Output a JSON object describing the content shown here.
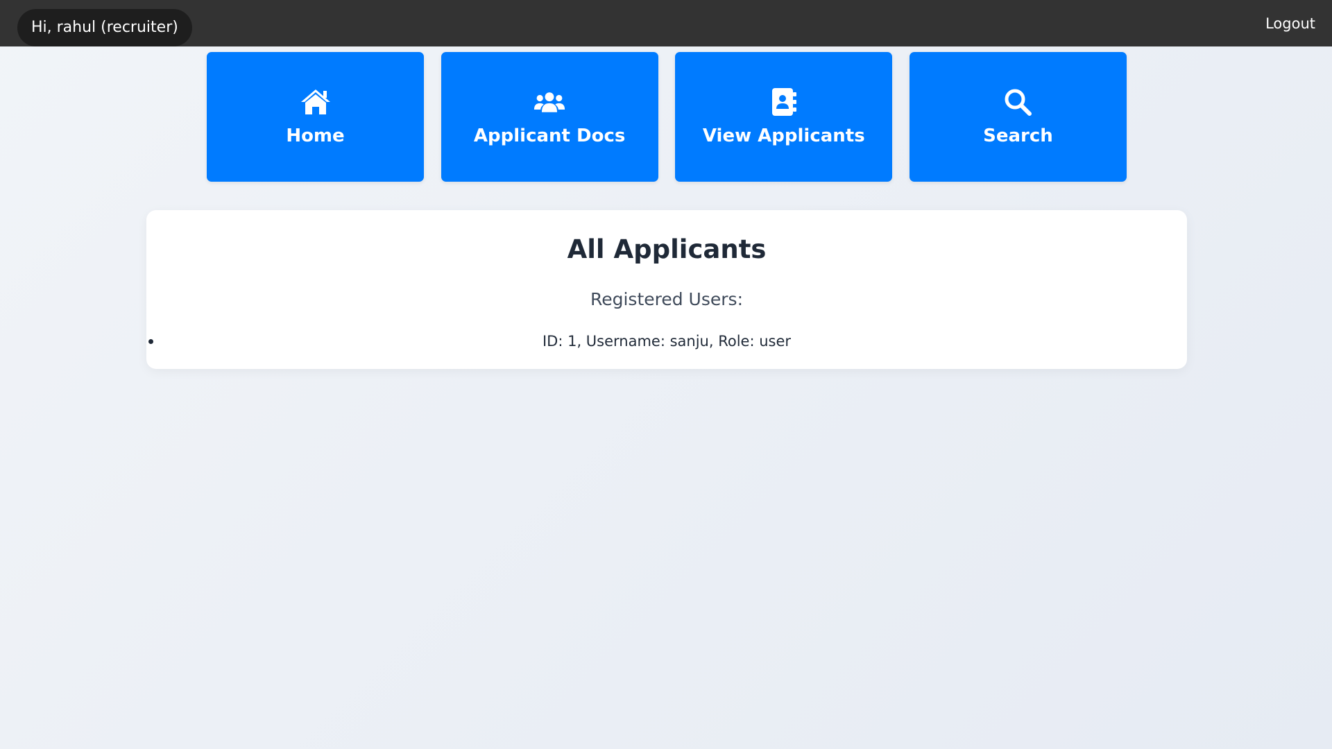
{
  "topbar": {
    "greeting": "Hi, rahul (recruiter)",
    "logout_label": "Logout"
  },
  "nav": [
    {
      "label": "Home",
      "icon": "home-icon"
    },
    {
      "label": "Applicant Docs",
      "icon": "users-icon"
    },
    {
      "label": "View Applicants",
      "icon": "address-book-icon"
    },
    {
      "label": "Search",
      "icon": "search-icon"
    }
  ],
  "panel": {
    "title": "All Applicants",
    "subtitle": "Registered Users:",
    "users": [
      {
        "text": "ID: 1, Username: sanju, Role: user"
      }
    ]
  },
  "colors": {
    "topbar": "#333333",
    "accent": "#007bff",
    "panel_bg": "#ffffff"
  }
}
